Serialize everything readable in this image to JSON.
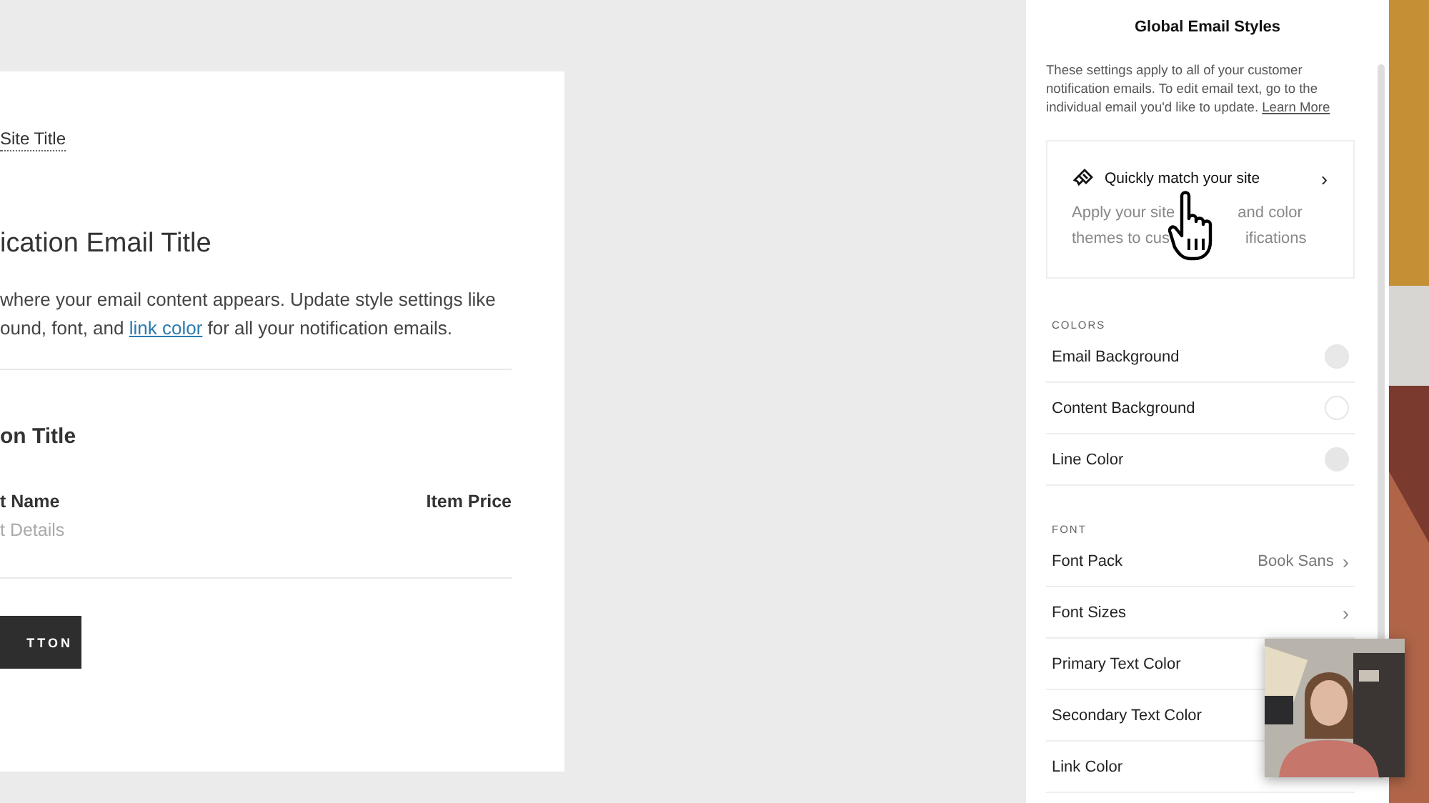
{
  "email_preview": {
    "site_title": "Site Title",
    "heading": "ication Email Title",
    "body": [
      "where your email content appears. Update style settings like",
      "ound, font, and "
    ],
    "body_link": "link color",
    "body_end": " for all your notification emails.",
    "section_title": "on Title",
    "item_name": "t Name",
    "item_price": "Item Price",
    "item_details": "t Details",
    "button": "TTON"
  },
  "panel": {
    "title": "Global Email Styles",
    "intro": "These settings apply to all of your customer notification emails. To edit email text, go to the individual email you'd like to update. ",
    "intro_link": "Learn More",
    "match_card": {
      "title": "Quickly match your site",
      "chevron": "›",
      "lines": [
        [
          "Apply your site",
          "and color"
        ],
        [
          "themes to cus",
          "ifications"
        ]
      ]
    },
    "sections": [
      {
        "label": "COLORS",
        "rows": [
          {
            "kind": "color",
            "label": "Email Background",
            "color": "#e8e8e8"
          },
          {
            "kind": "color",
            "label": "Content Background",
            "color": "#ffffff"
          },
          {
            "kind": "color",
            "label": "Line Color",
            "color": "#e6e6e6"
          }
        ]
      },
      {
        "label": "FONT",
        "rows": [
          {
            "kind": "nav",
            "label": "Font Pack",
            "value": "Book Sans",
            "chevron": "›"
          },
          {
            "kind": "nav",
            "label": "Font Sizes",
            "chevron": "›"
          },
          {
            "kind": "color",
            "label": "Primary Text Color"
          },
          {
            "kind": "color",
            "label": "Secondary Text Color"
          },
          {
            "kind": "color",
            "label": "Link Color"
          }
        ]
      }
    ]
  }
}
